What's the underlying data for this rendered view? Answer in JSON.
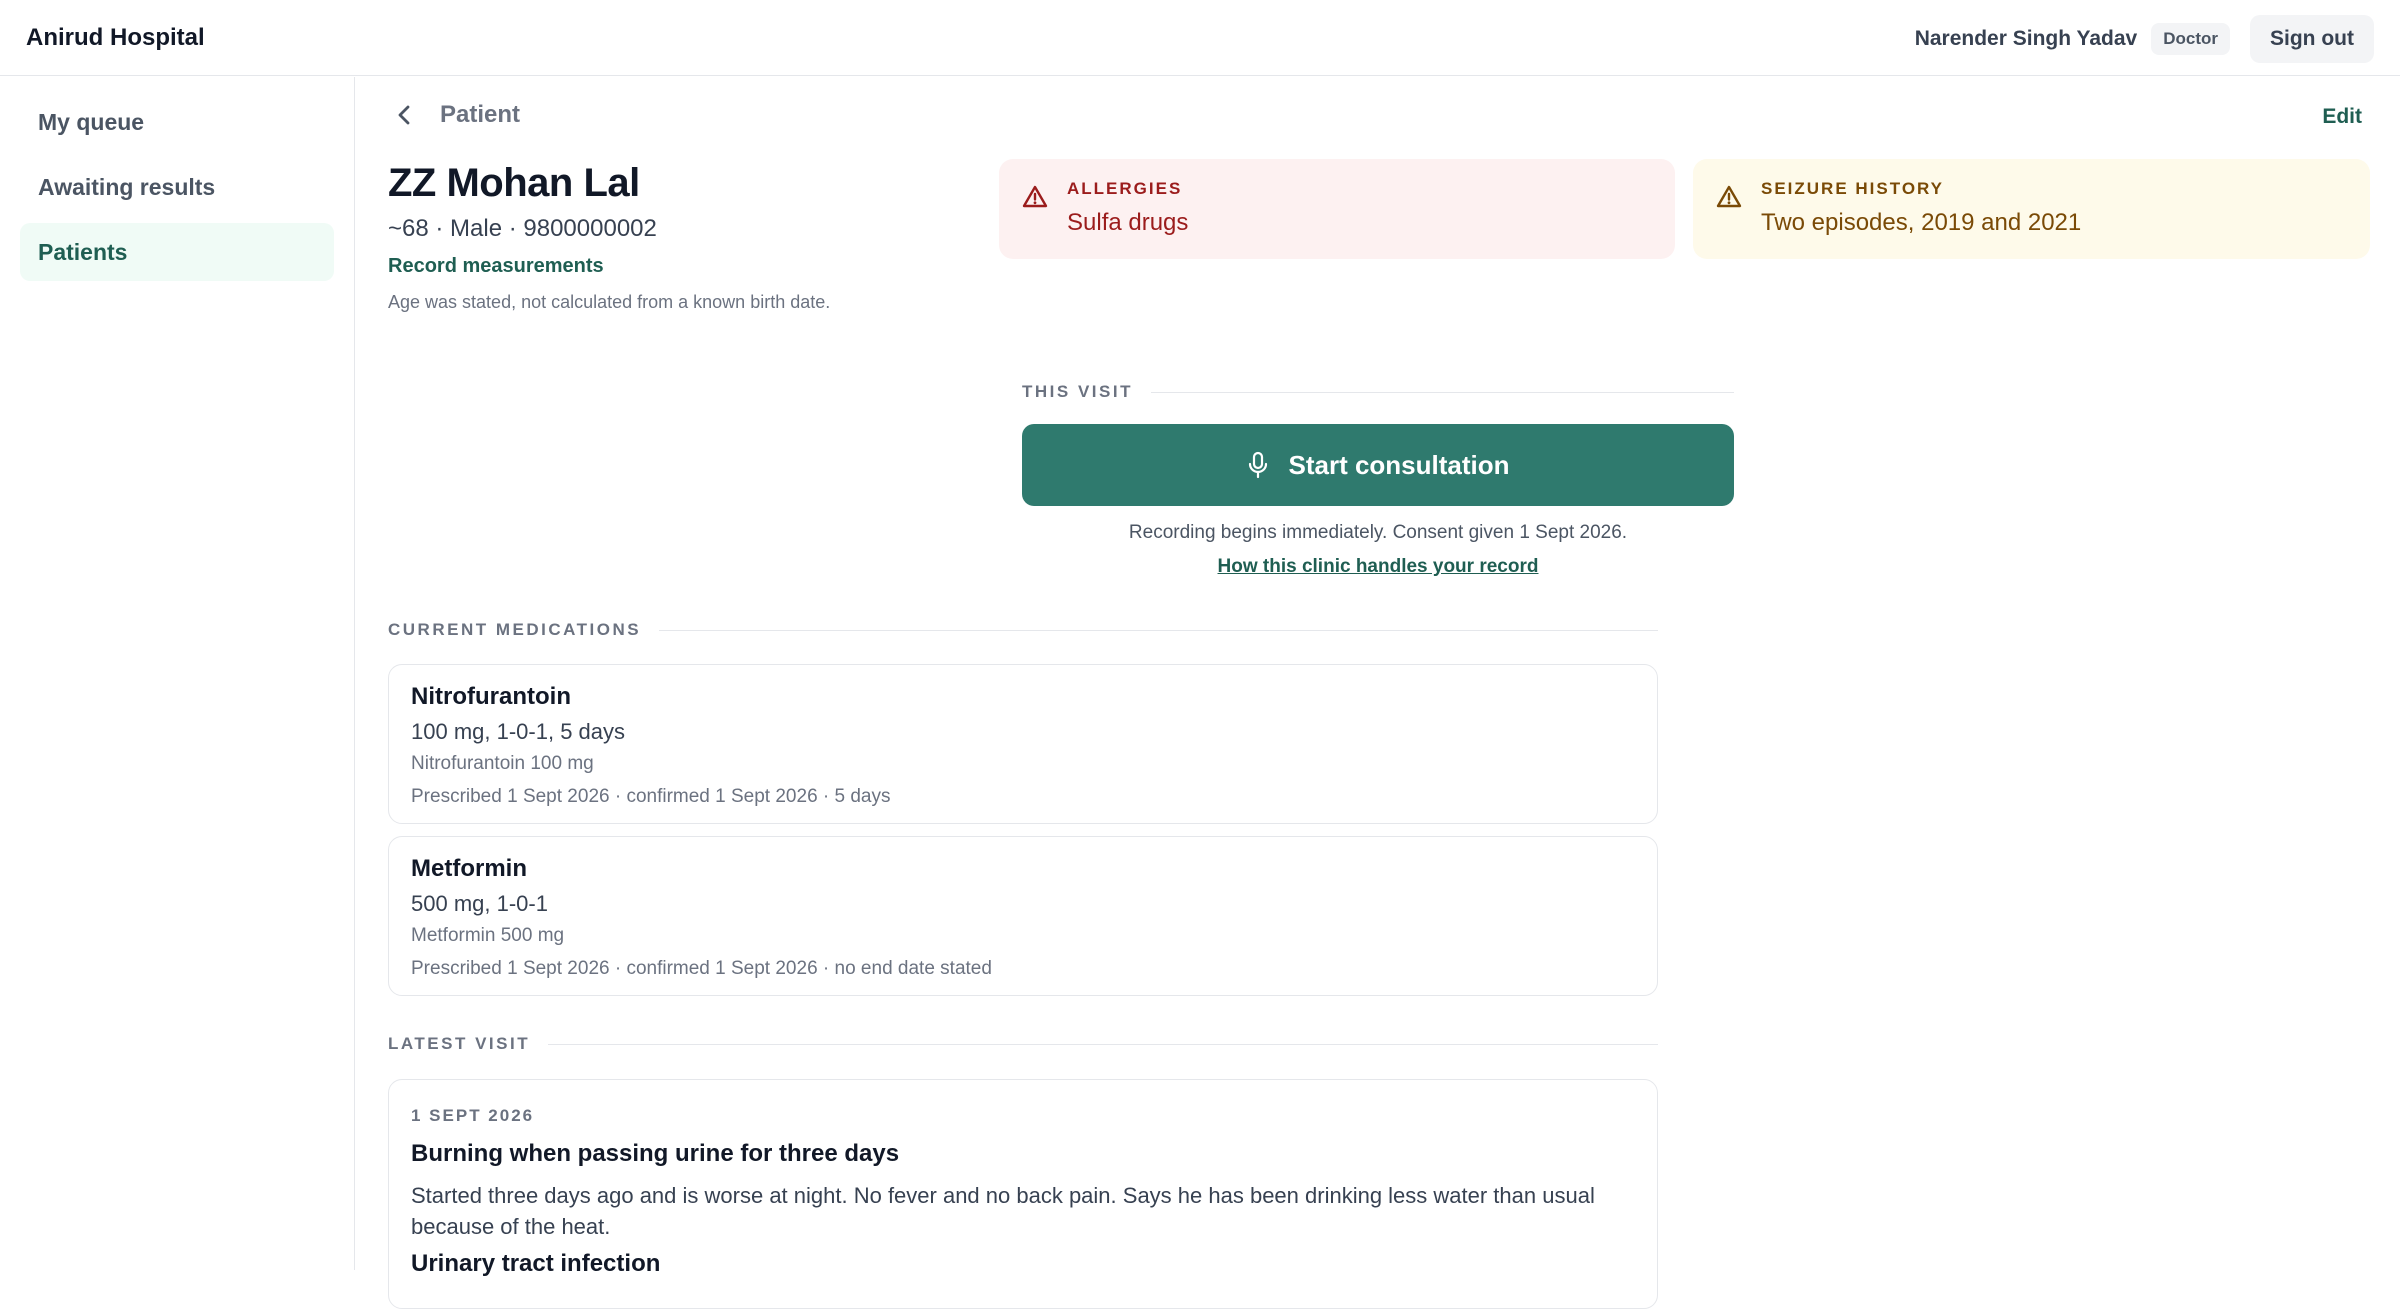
{
  "app": {
    "brand": "Anirud Hospital"
  },
  "user": {
    "name": "Narender Singh Yadav",
    "role": "Doctor",
    "signout_label": "Sign out"
  },
  "sidebar": {
    "items": [
      {
        "label": "My queue",
        "active": false
      },
      {
        "label": "Awaiting results",
        "active": false
      },
      {
        "label": "Patients",
        "active": true
      }
    ]
  },
  "header": {
    "back_label": "Patient",
    "edit_label": "Edit"
  },
  "patient": {
    "name": "ZZ Mohan Lal",
    "meta": "~68 · Male · 9800000002",
    "record_link": "Record measurements",
    "age_note": "Age was stated, not calculated from a known birth date."
  },
  "alerts": {
    "allergy": {
      "title": "ALLERGIES",
      "value": "Sulfa drugs",
      "icon": "warning-triangle-icon"
    },
    "seizure": {
      "title": "SEIZURE HISTORY",
      "value": "Two episodes, 2019 and 2021",
      "icon": "warning-triangle-icon"
    }
  },
  "this_visit": {
    "label": "THIS VISIT",
    "start_button": "Start consultation",
    "recording_note": "Recording begins immediately. Consent given 1 Sept 2026.",
    "policy_link": "How this clinic handles your record"
  },
  "medications": {
    "label": "CURRENT MEDICATIONS",
    "items": [
      {
        "name": "Nitrofurantoin",
        "dose": "100 mg, 1-0-1, 5 days",
        "generic": "Nitrofurantoin 100 mg",
        "history": "Prescribed 1 Sept 2026 · confirmed 1 Sept 2026 · 5 days"
      },
      {
        "name": "Metformin",
        "dose": "500 mg, 1-0-1",
        "generic": "Metformin 500 mg",
        "history": "Prescribed 1 Sept 2026 · confirmed 1 Sept 2026 · no end date stated"
      }
    ]
  },
  "latest_visit": {
    "label": "LATEST VISIT",
    "date": "1 SEPT 2026",
    "complaint": "Burning when passing urine for three days",
    "notes": "Started three days ago and is worse at night. No fever and no back pain. Says he has been drinking less water than usual because of the heat.",
    "diagnosis": "Urinary tract infection"
  },
  "colors": {
    "accent": "#2f7a6e",
    "allergy_bg": "#fdf1f1",
    "seizure_bg": "#fefaea"
  }
}
